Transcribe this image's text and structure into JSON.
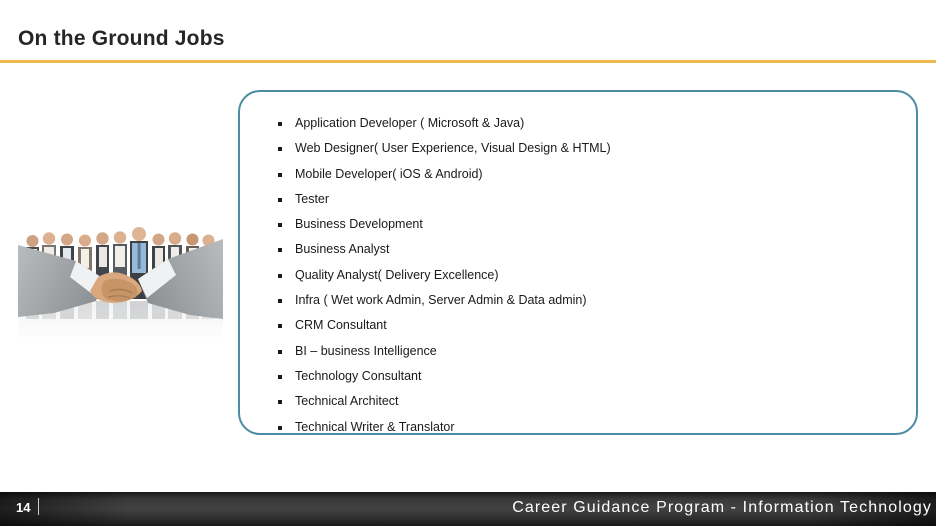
{
  "slide": {
    "title": "On the Ground Jobs",
    "accent_rule_color": "#eeb84d",
    "box_border_color": "#4b8ba3",
    "title_color": "#262626"
  },
  "image": {
    "alt": "business handshake with team of professionals",
    "name": "handshake-photo"
  },
  "bullets": [
    {
      "text": "Application Developer ( Microsoft & Java)"
    },
    {
      "text": "Web Designer( User Experience, Visual Design & HTML)"
    },
    {
      "text": "Mobile Developer( iOS & Android)"
    },
    {
      "text": "Tester"
    },
    {
      "text": "Business Development"
    },
    {
      "text": "Business Analyst"
    },
    {
      "text": "Quality Analyst( Delivery Excellence)"
    },
    {
      "text": "Infra ( Wet work Admin, Server Admin & Data admin)"
    },
    {
      "text": "CRM Consultant"
    },
    {
      "text": "BI – business Intelligence"
    },
    {
      "text": "Technology Consultant"
    },
    {
      "text": "Technical Architect"
    },
    {
      "text": "Technical Writer & Translator"
    }
  ],
  "footer": {
    "page_number": "14",
    "title": "Career Guidance Program - Information Technology",
    "background_color": "#2e2e2e",
    "text_color": "#ffffff"
  }
}
